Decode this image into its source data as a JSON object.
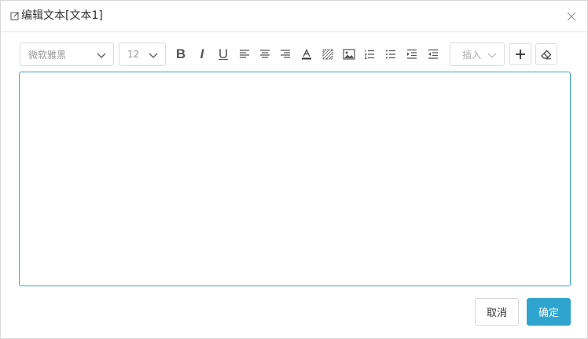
{
  "dialog": {
    "title": "编辑文本[文本1]"
  },
  "toolbar": {
    "font_family": "微软雅黑",
    "font_size": "12",
    "bold_label": "B",
    "italic_label": "I",
    "underline_label": "U",
    "insert_label": "插入",
    "icons": [
      "align-left-icon",
      "align-center-icon",
      "align-right-icon",
      "font-color-icon",
      "background-color-icon",
      "image-icon",
      "ordered-list-icon",
      "unordered-list-icon",
      "indent-icon",
      "outdent-icon",
      "plus-icon",
      "eraser-icon"
    ]
  },
  "editor": {
    "content": ""
  },
  "footer": {
    "cancel_label": "取消",
    "ok_label": "确定"
  },
  "colors": {
    "accent": "#2fa4cf",
    "editor_border": "#3aa3c8"
  }
}
